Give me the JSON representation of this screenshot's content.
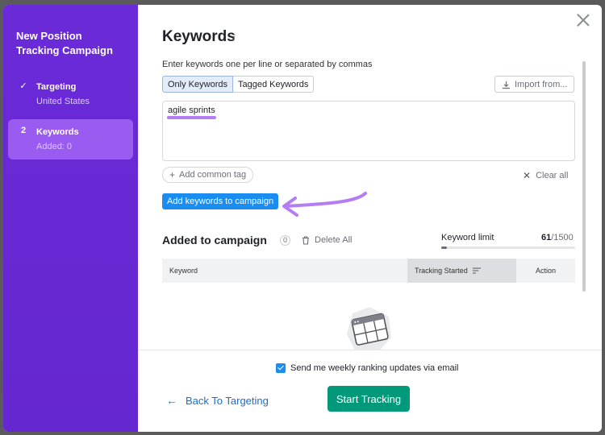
{
  "sidebar": {
    "title": "New Position Tracking Campaign",
    "steps": [
      {
        "mark": "✓",
        "name": "Targeting",
        "sub": "United States"
      },
      {
        "mark": "2",
        "name": "Keywords",
        "sub": "Added: 0"
      }
    ]
  },
  "header": {
    "title": "Keywords",
    "info": "i"
  },
  "input": {
    "instruction": "Enter keywords one per line or separated by commas",
    "tabs": [
      "Only Keywords",
      "Tagged Keywords"
    ],
    "import_label": "Import from...",
    "value": "agile sprints",
    "add_tag_label": "Add common tag",
    "clear_label": "Clear all",
    "add_button_label": "Add keywords to campaign"
  },
  "added": {
    "title": "Added to campaign",
    "count": "0",
    "delete_label": "Delete All",
    "limit_label": "Keyword limit",
    "limit_used": "61",
    "limit_total": "/1500",
    "limit_fraction": 0.0407,
    "columns": [
      "Keyword",
      "Tracking Started",
      "Action"
    ]
  },
  "footer": {
    "email_label": "Send me weekly ranking updates via email",
    "email_checked": true,
    "back_label": "Back To Targeting",
    "start_label": "Start Tracking"
  },
  "colors": {
    "sidebar": "#6b2ad8",
    "active_step": "#9a5cf0",
    "primary": "#1a8df0",
    "start": "#00997a",
    "annotation": "#b57df2"
  }
}
